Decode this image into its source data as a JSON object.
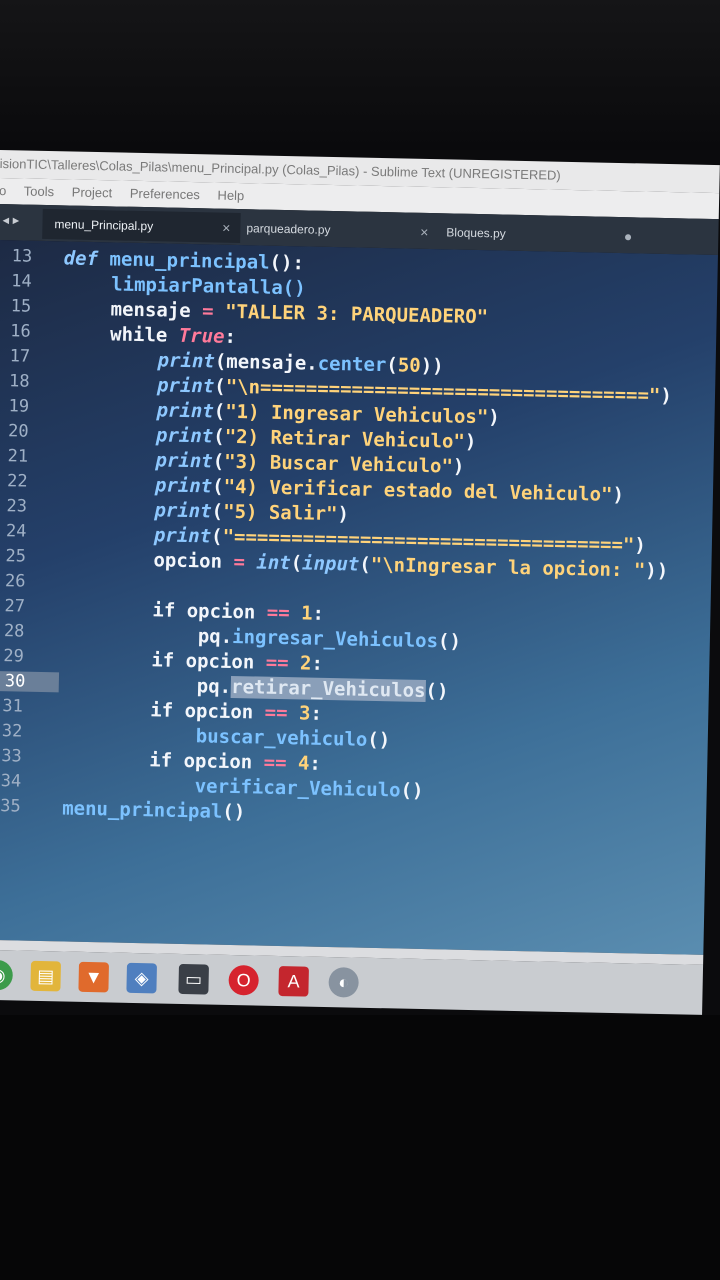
{
  "window": {
    "title": "isionTIC\\Talleres\\Colas_Pilas\\menu_Principal.py (Colas_Pilas) - Sublime Text (UNREGISTERED)",
    "menu": [
      "o",
      "Tools",
      "Project",
      "Preferences",
      "Help"
    ]
  },
  "tabs": [
    {
      "label": "menu_Principal.py",
      "close": "×"
    },
    {
      "label": "parqueadero.py",
      "close": "×"
    },
    {
      "label": "Bloques.py",
      "close": "●"
    }
  ],
  "nav": "◂ ▸",
  "line_numbers": [
    "13",
    "14",
    "15",
    "16",
    "17",
    "18",
    "19",
    "20",
    "21",
    "22",
    "23",
    "24",
    "25",
    "26",
    "27",
    "28",
    "29",
    "30",
    "31",
    "32",
    "33",
    "34",
    "35"
  ],
  "current_line": "30",
  "code": {
    "l13": {
      "def": "def",
      "name": " menu_principal",
      "rest": "():"
    },
    "l14": {
      "text": "limpiarPantalla()"
    },
    "l15": {
      "var": "mensaje",
      "eq": " = ",
      "str": "\"TALLER 3: PARQUEADERO\""
    },
    "l16": {
      "while": "while",
      "true": " True",
      "colon": ":"
    },
    "l17": {
      "print": "print",
      "mid": "(mensaje.",
      "center": "center",
      "open": "(",
      "num": "50",
      "close": "))"
    },
    "l18": {
      "print": "print",
      "open": "(",
      "str": "\"\\n==================================\"",
      "close": ")"
    },
    "l19": {
      "print": "print",
      "open": "(",
      "str": "\"1) Ingresar Vehiculos\"",
      "close": ")"
    },
    "l20": {
      "print": "print",
      "open": "(",
      "str": "\"2) Retirar Vehiculo\"",
      "close": ")"
    },
    "l21": {
      "print": "print",
      "open": "(",
      "str": "\"3) Buscar Vehiculo\"",
      "close": ")"
    },
    "l22": {
      "print": "print",
      "open": "(",
      "str": "\"4) Verificar estado del Vehiculo\"",
      "close": ")"
    },
    "l23": {
      "print": "print",
      "open": "(",
      "str": "\"5) Salir\"",
      "close": ")"
    },
    "l24": {
      "print": "print",
      "open": "(",
      "str": "\"==================================\"",
      "close": ")"
    },
    "l25": {
      "var": "opcion",
      "eq": " = ",
      "int": "int",
      "open": "(",
      "input": "input",
      "open2": "(",
      "str": "\"\\nIngresar la opcion: \"",
      "close": "))"
    },
    "l27": {
      "if": "if",
      "cond": " opcion ",
      "op": "==",
      "num": " 1",
      "colon": ":"
    },
    "l28": {
      "obj": "pq.",
      "fn": "ingresar_Vehiculos",
      "call": "()"
    },
    "l29": {
      "if": "if",
      "cond": " opcion ",
      "op": "==",
      "num": " 2",
      "colon": ":"
    },
    "l30": {
      "obj": "pq.",
      "fn": "retirar_Vehiculos",
      "call": "()"
    },
    "l31": {
      "if": "if",
      "cond": " opcion ",
      "op": "==",
      "num": " 3",
      "colon": ":"
    },
    "l32": {
      "fn": "buscar_vehiculo",
      "call": "()"
    },
    "l33": {
      "if": "if",
      "cond": " opcion ",
      "op": "==",
      "num": " 4",
      "colon": ":"
    },
    "l34": {
      "fn": "verificar_Vehiculo",
      "call": "()"
    },
    "l35": {
      "fn": "menu_principal",
      "call": "()"
    }
  },
  "taskbar": [
    "chrome-icon",
    "file-explorer-icon",
    "brave-icon",
    "virtualbox-icon",
    "terminal-icon",
    "opera-icon",
    "acrobat-icon",
    "app-icon"
  ]
}
